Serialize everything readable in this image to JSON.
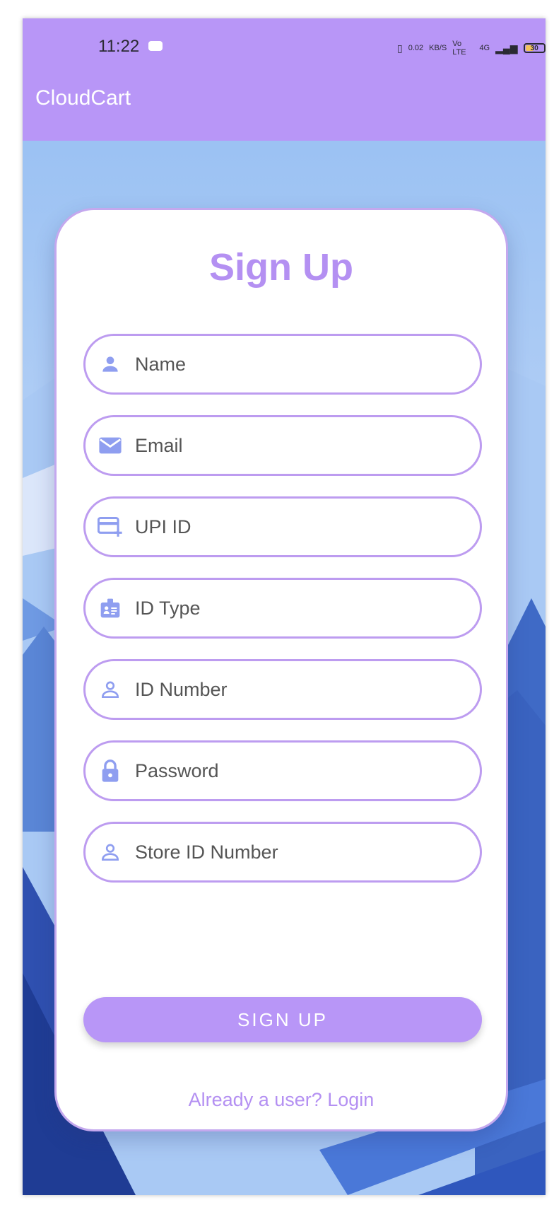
{
  "status_bar": {
    "time": "11:22",
    "network_speed": "0.02",
    "network_unit": "KB/S",
    "volte_label": "Vo LTE",
    "signal_label": "4G",
    "battery_level": "30"
  },
  "app_bar": {
    "title": "CloudCart"
  },
  "form": {
    "title": "Sign Up",
    "fields": [
      {
        "placeholder": "Name",
        "value": "",
        "icon": "person-icon"
      },
      {
        "placeholder": "Email",
        "value": "",
        "icon": "email-icon"
      },
      {
        "placeholder": "UPI ID",
        "value": "",
        "icon": "card-add-icon"
      },
      {
        "placeholder": "ID Type",
        "value": "",
        "icon": "id-badge-icon"
      },
      {
        "placeholder": "ID Number",
        "value": "",
        "icon": "person-outline-icon"
      },
      {
        "placeholder": "Password",
        "value": "",
        "icon": "lock-icon"
      },
      {
        "placeholder": "Store ID Number",
        "value": "",
        "icon": "person-outline-icon"
      }
    ],
    "submit_label": "SIGN UP",
    "login_link": "Already a user? Login"
  },
  "colors": {
    "accent": "#b896f7",
    "icon": "#8f9ef0",
    "card_border": "#bd9cf0",
    "background_sky": "#9cc3f3"
  }
}
